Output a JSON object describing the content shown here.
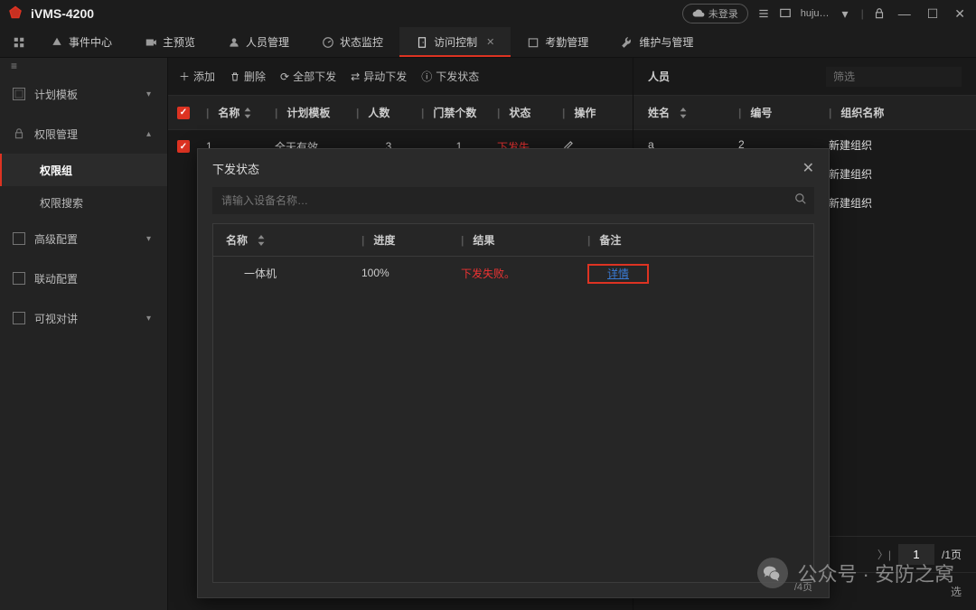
{
  "titlebar": {
    "app_title": "iVMS-4200",
    "not_logged": "未登录",
    "user": "huju…"
  },
  "menu": {
    "event": "事件中心",
    "preview": "主预览",
    "person": "人员管理",
    "status": "状态监控",
    "access": "访问控制",
    "attend": "考勤管理",
    "maintain": "维护与管理"
  },
  "sidebar": {
    "plan": "计划模板",
    "perm": "权限管理",
    "perm_group": "权限组",
    "perm_search": "权限搜索",
    "advanced": "高级配置",
    "linkage": "联动配置",
    "intercom": "可视对讲"
  },
  "toolbar": {
    "add": "添加",
    "del": "删除",
    "apply_all": "全部下发",
    "apply_diff": "异动下发",
    "apply_status": "下发状态"
  },
  "table": {
    "h_name": "名称",
    "h_plan": "计划模板",
    "h_pcount": "人数",
    "h_door": "门禁个数",
    "h_status": "状态",
    "h_op": "操作",
    "r1_name": "1",
    "r1_plan": "全天有效",
    "r1_pcount": "3",
    "r1_door": "1",
    "r1_status": "下发失…"
  },
  "right": {
    "title": "人员",
    "filter_ph": "筛选",
    "h_name": "姓名",
    "h_id": "编号",
    "h_org": "组织名称",
    "rows": [
      {
        "name": "a",
        "id": "2",
        "org": "新建组织"
      },
      {
        "name": "",
        "id": "",
        "org": "新建组织"
      },
      {
        "name": "",
        "id": "",
        "org": "新建组织"
      }
    ],
    "page": "1",
    "page_total": "/1页",
    "filter_tail": "选"
  },
  "modal": {
    "title": "下发状态",
    "search_ph": "请输入设备名称…",
    "h_name": "名称",
    "h_prog": "进度",
    "h_res": "结果",
    "h_note": "备注",
    "r_name": "一体机",
    "r_prog": "100%",
    "r_res": "下发失败。",
    "r_note": "详情",
    "corner": "/4页"
  },
  "wm": {
    "text": "公众号 · 安防之窝"
  }
}
